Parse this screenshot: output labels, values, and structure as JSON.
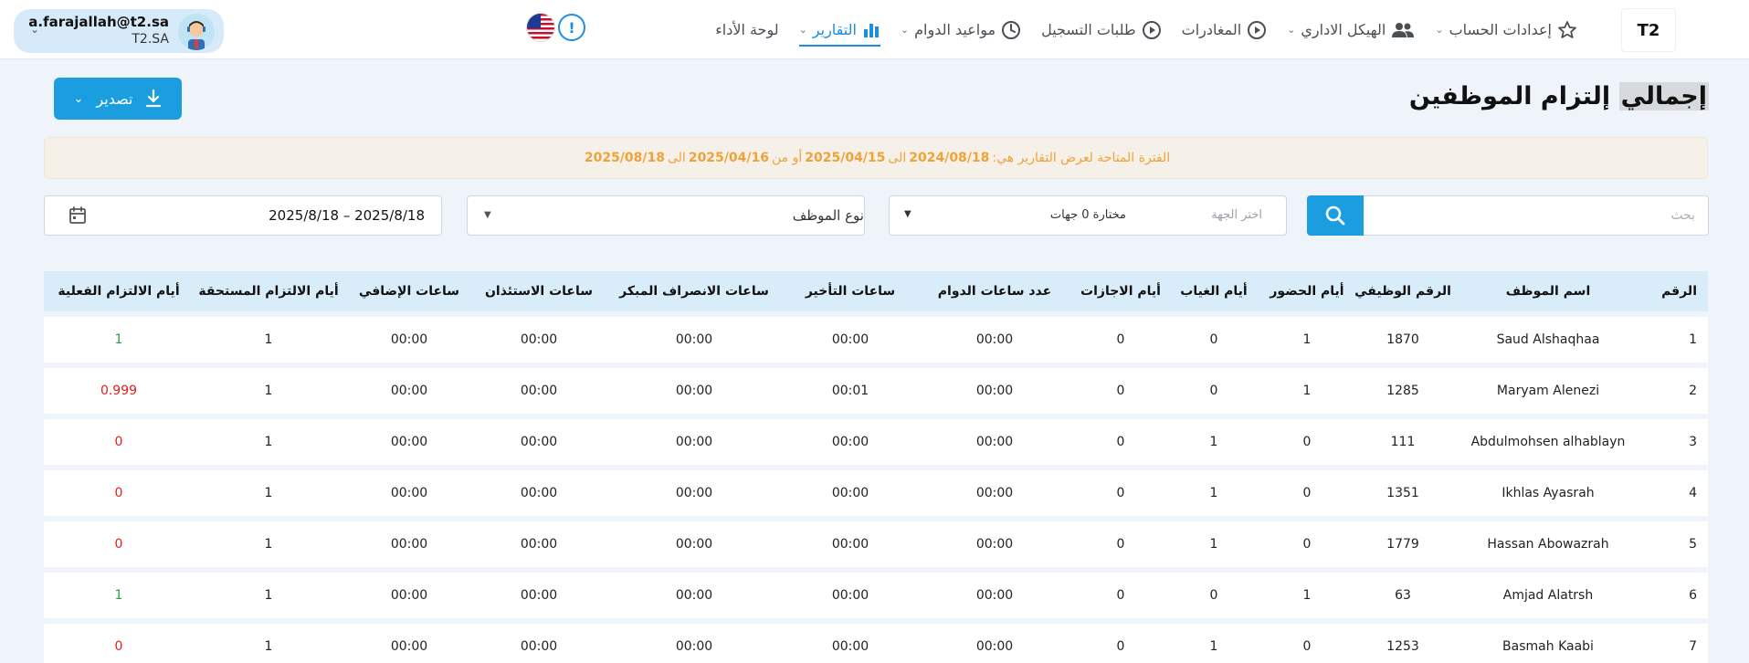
{
  "nav": {
    "items": [
      {
        "id": "dashboard",
        "label": "لوحة الأداء",
        "icon": "none",
        "chevron": false
      },
      {
        "id": "reports",
        "label": "التقارير",
        "icon": "bar-chart-icon",
        "chevron": true,
        "active": true
      },
      {
        "id": "schedules",
        "label": "مواعيد الدوام",
        "icon": "clock-icon",
        "chevron": true
      },
      {
        "id": "registration",
        "label": "طلبات التسجيل",
        "icon": "play-circle-icon",
        "chevron": false
      },
      {
        "id": "departures",
        "label": "المغادرات",
        "icon": "play-circle-icon",
        "chevron": false
      },
      {
        "id": "structure",
        "label": "الهيكل الاداري",
        "icon": "users-icon",
        "chevron": true
      },
      {
        "id": "account",
        "label": "إعدادات الحساب",
        "icon": "star-icon",
        "chevron": true
      }
    ]
  },
  "user": {
    "email": "a.farajallah@t2.sa",
    "org": "T2.SA"
  },
  "logo": {
    "text": "T2"
  },
  "page": {
    "title_part1": "إجمالي",
    "title_part2": " إلتزام الموظفين",
    "export_label": "تصدير"
  },
  "notice": {
    "prefix": "الفترة المتاحة لعرض التقارير هي:",
    "from1": "2024/08/18",
    "mid1": "الى",
    "to1": "2025/04/15",
    "mid2": "أو من",
    "from2": "2025/04/16",
    "mid3": "الى",
    "to2": "2025/08/18"
  },
  "filters": {
    "search_placeholder": "بحث",
    "dept_placeholder": "اختر الجهة",
    "dept_value": "مختارة 0 جهات",
    "type_placeholder": "نوع الموظف",
    "date_range": "2025/8/18 – 2025/8/18"
  },
  "table": {
    "headers": [
      "الرقم",
      "اسم الموظف",
      "الرقم الوظيفي",
      "أيام الحضور",
      "أيام الغياب",
      "أيام الاجازات",
      "عدد ساعات الدوام",
      "ساعات التأخير",
      "ساعات الانصراف المبكر",
      "ساعات الاستئذان",
      "ساعات الإضافي",
      "أيام الالتزام المستحقة",
      "أيام الالتزام الفعلية"
    ],
    "rows": [
      {
        "no": "1",
        "name": "Saud Alshaqhaa",
        "emp_id": "1870",
        "present": "1",
        "absent": "0",
        "leave": "0",
        "hours": "00:00",
        "late": "00:00",
        "early": "00:00",
        "perm": "00:00",
        "overtime": "00:00",
        "due": "1",
        "actual": "1",
        "actual_status": "green"
      },
      {
        "no": "2",
        "name": "Maryam Alenezi",
        "emp_id": "1285",
        "present": "1",
        "absent": "0",
        "leave": "0",
        "hours": "00:00",
        "late": "00:01",
        "early": "00:00",
        "perm": "00:00",
        "overtime": "00:00",
        "due": "1",
        "actual": "0.999",
        "actual_status": "red"
      },
      {
        "no": "3",
        "name": "Abdulmohsen alhablayn",
        "emp_id": "111",
        "present": "0",
        "absent": "1",
        "leave": "0",
        "hours": "00:00",
        "late": "00:00",
        "early": "00:00",
        "perm": "00:00",
        "overtime": "00:00",
        "due": "1",
        "actual": "0",
        "actual_status": "red"
      },
      {
        "no": "4",
        "name": "Ikhlas Ayasrah",
        "emp_id": "1351",
        "present": "0",
        "absent": "1",
        "leave": "0",
        "hours": "00:00",
        "late": "00:00",
        "early": "00:00",
        "perm": "00:00",
        "overtime": "00:00",
        "due": "1",
        "actual": "0",
        "actual_status": "red"
      },
      {
        "no": "5",
        "name": "Hassan Abowazrah",
        "emp_id": "1779",
        "present": "0",
        "absent": "1",
        "leave": "0",
        "hours": "00:00",
        "late": "00:00",
        "early": "00:00",
        "perm": "00:00",
        "overtime": "00:00",
        "due": "1",
        "actual": "0",
        "actual_status": "red"
      },
      {
        "no": "6",
        "name": "Amjad Alatrsh",
        "emp_id": "63",
        "present": "1",
        "absent": "0",
        "leave": "0",
        "hours": "00:00",
        "late": "00:00",
        "early": "00:00",
        "perm": "00:00",
        "overtime": "00:00",
        "due": "1",
        "actual": "1",
        "actual_status": "green"
      },
      {
        "no": "7",
        "name": "Basmah Kaabi",
        "emp_id": "1253",
        "present": "0",
        "absent": "1",
        "leave": "0",
        "hours": "00:00",
        "late": "00:00",
        "early": "00:00",
        "perm": "00:00",
        "overtime": "00:00",
        "due": "1",
        "actual": "0",
        "actual_status": "red"
      }
    ]
  },
  "colors": {
    "accent": "#1a9ee0",
    "green": "#2a9d3f",
    "red": "#e02020",
    "notice": "#f0a23a"
  }
}
